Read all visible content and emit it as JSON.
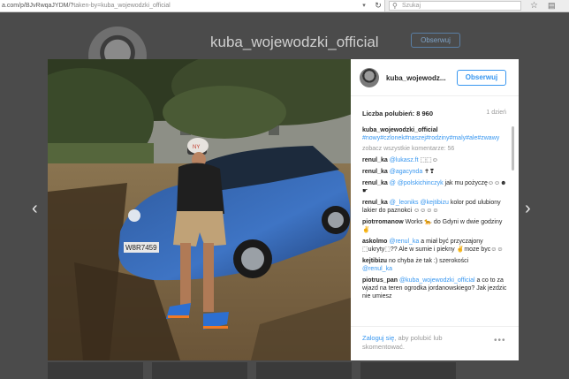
{
  "browser": {
    "url_prefix": "a.com/p/BJvRwqaJYDM/?",
    "url_rest": "taken-by=kuba_wojewodzki_official",
    "search_placeholder": "Szukaj"
  },
  "profile": {
    "username": "kuba_wojewodzki_official",
    "follow_label": "Obserwuj"
  },
  "post": {
    "username": "kuba_wojewodz...",
    "follow_label": "Obserwuj",
    "likes": "Liczba polubień: 8 960",
    "time": "1 dzień",
    "caption_user": "kuba_wojewodzki_official",
    "caption_tags": "#nowy#czlonek#naszej#rodziny#maly#ale#zwawy",
    "view_all": "zobacz wszystkie komentarze: 56",
    "license_plate": "W8R7459",
    "cap_text": "NY"
  },
  "comments": [
    {
      "user": "renul_ka",
      "link": "@lukasz.ft",
      "text": " ⬚⬚☺"
    },
    {
      "user": "renul_ka",
      "link": "@agacynda",
      "text": " ✝❣"
    },
    {
      "user": "renul_ka",
      "link": "@ @polskichinczyk",
      "text": " jak mu pożyczę☺☺☻☛"
    },
    {
      "user": "renul_ka",
      "link": "@_leoniks @kejtibizu",
      "text": " kolor pod ulubiony lakier do paznokci ☺☺☺☺"
    },
    {
      "user": "piotrromanow",
      "link": "",
      "text": " Works 🐆 do Gdyni w dwie godziny ✌"
    },
    {
      "user": "askolmo",
      "link": "@renul_ka",
      "text": " a miał być przyczajony ⬚ukryty⬚?? Ale w sumie i piekny ✌moze byc☺☺"
    },
    {
      "user": "kejtibizu",
      "link": "",
      "text": " no chyba że tak :) szerokości"
    },
    {
      "user": "",
      "link": "@renul_ka",
      "text": ""
    },
    {
      "user": "piotrus_pan",
      "link": "@kuba_wojewodzki_official",
      "text": " a co to za wjazd na teren ogrodka jordanowskiego? Jak jezdzic nie umiesz"
    }
  ],
  "footer": {
    "login_link": "Zaloguj się",
    "login_text": ", aby polubić lub skomentować."
  }
}
